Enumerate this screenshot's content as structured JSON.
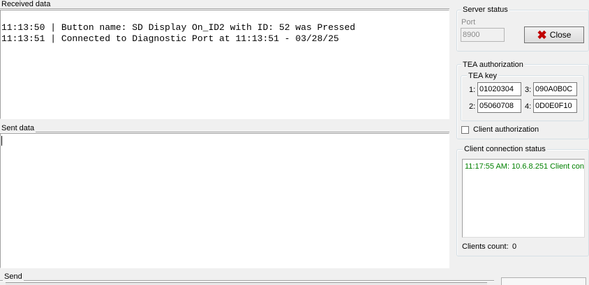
{
  "received": {
    "label": "Received data",
    "lines": [
      "11:13:50 | Button name: SD Display On_ID2 with ID: 52 was Pressed",
      "11:13:51 | Connected to Diagnostic Port at 11:13:51 - 03/28/25"
    ]
  },
  "sent": {
    "label": "Sent data"
  },
  "send": {
    "label": "Send"
  },
  "server_status": {
    "label": "Server status",
    "port_label": "Port",
    "port_value": "8900",
    "close_label": "Close"
  },
  "tea": {
    "label": "TEA authorization",
    "key_label": "TEA key",
    "keys": [
      {
        "index": "1:",
        "value": "01020304"
      },
      {
        "index": "2:",
        "value": "05060708"
      },
      {
        "index": "3:",
        "value": "090A0B0C"
      },
      {
        "index": "4:",
        "value": "0D0E0F10"
      }
    ],
    "client_auth_label": "Client authorization",
    "client_auth_checked": false
  },
  "client_status": {
    "label": "Client connection status",
    "entries": [
      "11:17:55 AM:  10.6.8.251 Client con"
    ],
    "entry_color": "#008000",
    "clients_count_label": "Clients count:",
    "clients_count_value": "0"
  }
}
